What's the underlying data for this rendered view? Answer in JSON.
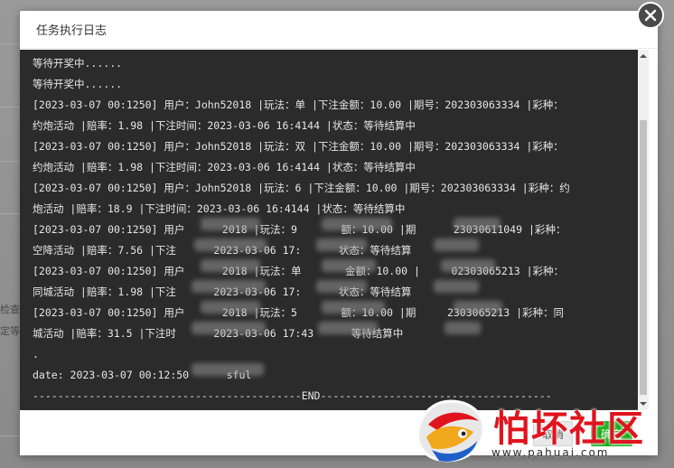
{
  "background": {
    "side_texts": [
      "检查",
      "定等"
    ]
  },
  "modal": {
    "title": "任务执行日志",
    "close_icon": "close-icon"
  },
  "log": {
    "lines": [
      "等待开奖中......",
      "等待开奖中......",
      "[2023-03-07 00:1250] 用户：John52018 |玩法：单 |下注金额：10.00 |期号：202303063334 |彩种：",
      "约炮活动 |赔率：1.98 |下注时间：2023-03-06 16:4144 |状态：等待结算中",
      "[2023-03-07 00:1250] 用户：John52018 |玩法：双 |下注金额：10.00 |期号：202303063334 |彩种：",
      "约炮活动 |赔率：1.98 |下注时间：2023-03-06 16:4144 |状态：等待结算中",
      "[2023-03-07 00:1250] 用户：John52018 |玩法：6 |下注金额：10.00 |期号：202303063334 |彩种：约",
      "炮活动 |赔率：18.9 |下注时间：2023-03-06 16:4144 |状态：等待结算中",
      "[2023-03-07 00:1250] 用户      2018 |玩法：9       额：10.00 |期      23030611049 |彩种：",
      "空降活动 |赔率：7.56 |下注      2023-03-06 17:      状态：等待结算",
      "[2023-03-07 00:1250] 用户      2018 |玩法：单       金额：10.00 |     02303065213 |彩种：",
      "同城活动 |赔率：1.98 |下注      2023-03-06 17:      状态：等待结算",
      "[2023-03-07 00:1250] 用户      2018 |玩法：5       额：10.00 |期     2303065213 |彩种：同",
      "城活动 |赔率：31.5 |下注时      2023-03-06 17:43      等待结算中",
      ".",
      "date: 2023-03-07 00:12:50      sful",
      "-------------------------------------------END-------------------------------------"
    ]
  },
  "footer": {
    "cancel_label": "取消",
    "confirm_label": "确定"
  },
  "watermark": {
    "text": "怕坏社区",
    "url": "www.pahuai.com"
  },
  "colors": {
    "log_bg": "#2b2b2b",
    "log_text": "#e6e6e6",
    "confirm": "#1aad19",
    "watermark": "#e0141e"
  }
}
